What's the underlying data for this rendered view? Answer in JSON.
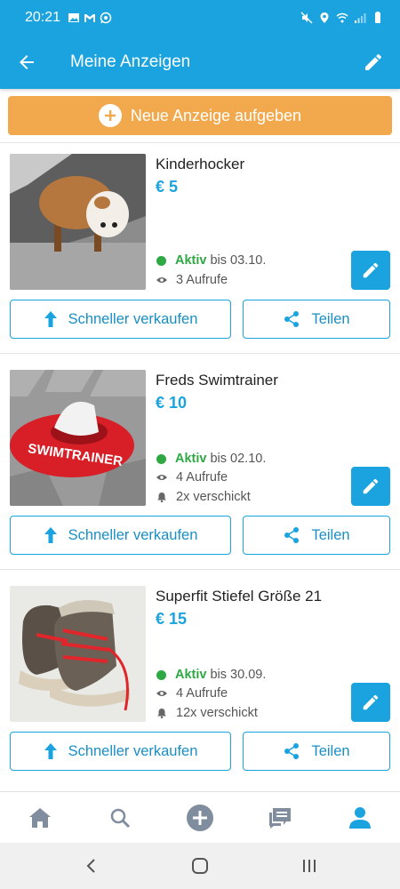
{
  "status_bar": {
    "time": "20:21",
    "left_icons": [
      "gallery-icon",
      "gmail-icon",
      "whatsapp-icon"
    ],
    "right_icons": [
      "mute-icon",
      "location-icon",
      "wifi-icon",
      "signal-icon",
      "battery-icon"
    ]
  },
  "app_bar": {
    "title": "Meine Anzeigen",
    "back_icon": "arrow-back-icon",
    "edit_icon": "pencil-icon"
  },
  "new_ad_button": {
    "label": "Neue Anzeige aufgeben",
    "icon": "plus-circle-icon"
  },
  "listings": [
    {
      "title": "Kinderhocker",
      "price": "€ 5",
      "status": "Aktiv",
      "until": "bis 03.10.",
      "views": "3 Aufrufe",
      "sent": "",
      "image": "stool-photo",
      "sell_faster_label": "Schneller verkaufen",
      "share_label": "Teilen"
    },
    {
      "title": "Freds Swimtrainer",
      "price": "€ 10",
      "status": "Aktiv",
      "until": "bis 02.10.",
      "views": "4 Aufrufe",
      "sent": "2x verschickt",
      "image": "swimtrainer-photo",
      "sell_faster_label": "Schneller verkaufen",
      "share_label": "Teilen"
    },
    {
      "title": "Superfit Stiefel Größe 21",
      "price": "€ 15",
      "status": "Aktiv",
      "until": "bis 30.09.",
      "views": "4 Aufrufe",
      "sent": "12x verschickt",
      "image": "boots-photo",
      "sell_faster_label": "Schneller verkaufen",
      "share_label": "Teilen"
    }
  ],
  "bottom_nav": {
    "items": [
      "home-icon",
      "search-icon",
      "add-icon",
      "messages-icon",
      "profile-icon"
    ],
    "active": "profile-icon"
  },
  "system_nav": [
    "back",
    "home",
    "recents"
  ],
  "colors": {
    "primary": "#1aa3df",
    "accent_orange": "#f2a94d",
    "active_green": "#2ea843",
    "nav_inactive": "#7f8d9e"
  }
}
